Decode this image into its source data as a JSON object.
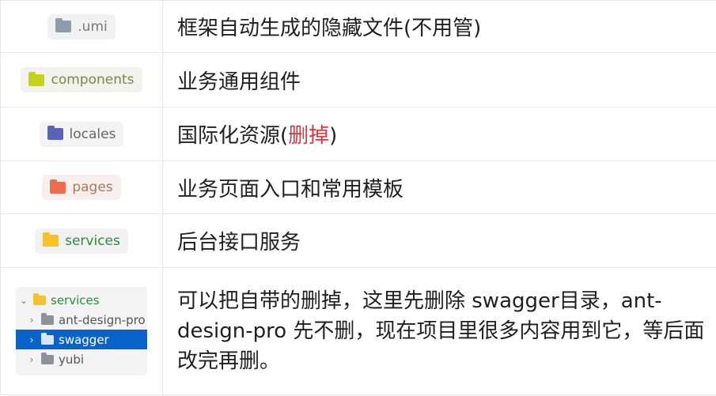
{
  "rows": [
    {
      "folder": ".umi",
      "description": "框架自动生成的隐藏文件(不用管)"
    },
    {
      "folder": "components",
      "description": "业务通用组件"
    },
    {
      "folder": "locales",
      "description_before": "国际化资源(",
      "description_red": "删掉",
      "description_after": ")"
    },
    {
      "folder": "pages",
      "description": "业务页面入口和常用模板"
    },
    {
      "folder": "services",
      "description": "后台接口服务"
    }
  ],
  "last_row": {
    "tree": {
      "root": "services",
      "children": [
        "ant-design-pro",
        "swagger",
        "yubi"
      ],
      "selected": "swagger"
    },
    "description": "可以把自带的删掉，这里先删除 swagger目录，ant-design-pro 先不删，现在项目里很多内容用到它，等后面改完再删。"
  },
  "colors": {
    "selected": "#0a63c9",
    "red": "#d9363e",
    "umi": "#8d9bab",
    "components": "#c5d11f",
    "locales": "#5a63b8",
    "pages": "#ee6b4d",
    "services": "#f6c12a"
  },
  "icons": [
    "folder-icon",
    "folder-icon",
    "translate-folder-icon",
    "folder-icon",
    "folder-icon"
  ]
}
